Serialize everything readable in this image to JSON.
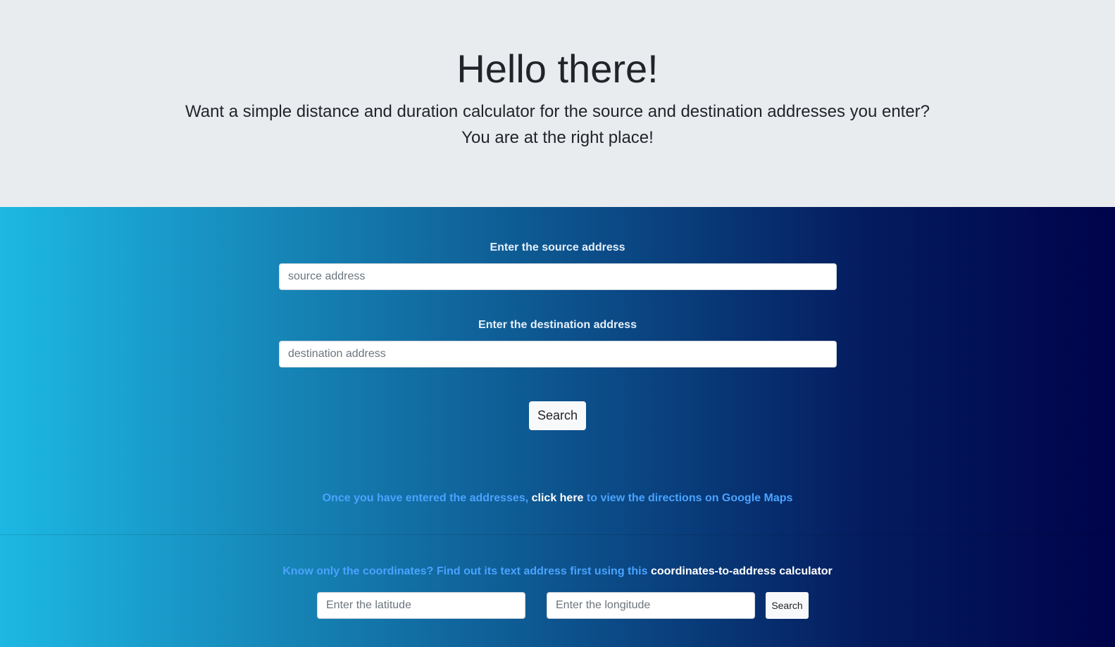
{
  "hero": {
    "title": "Hello there!",
    "lead_line1": "Want a simple distance and duration calculator for the source and destination addresses you enter?",
    "lead_line2": "You are at the right place!"
  },
  "source": {
    "label": "Enter the source address",
    "placeholder": "source address"
  },
  "destination": {
    "label": "Enter the destination address",
    "placeholder": "destination address"
  },
  "search_button": "Search",
  "directions": {
    "prefix": "Once you have entered the addresses,",
    "link": "click here",
    "suffix": "to view the directions on Google Maps"
  },
  "coordinates": {
    "prefix": "Know only the coordinates? Find out its text address first using this",
    "link": "coordinates-to-address calculator",
    "latitude_placeholder": "Enter the latitude",
    "longitude_placeholder": "Enter the longitude",
    "search_button": "Search"
  },
  "colors": {
    "hero_background": "#e9ecef",
    "gradient_start": "#1db8e3",
    "gradient_end": "#00034a",
    "info_text": "#4aa3ff",
    "link_text": "#ffffff"
  }
}
